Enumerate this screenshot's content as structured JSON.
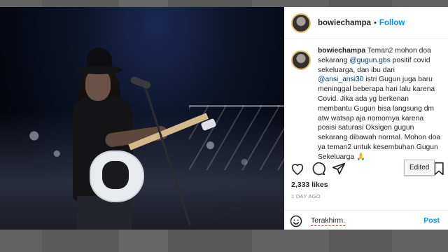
{
  "post": {
    "username": "bowiechampa",
    "follow_label": "Follow",
    "separator": "•",
    "caption": {
      "username": "bowiechampa",
      "text_1": " Teman2 mohon doa sekarang ",
      "mention_1": "@gugun.gbs",
      "text_2": " positif covid sekeluarga, dan ibu dari ",
      "mention_2": "@ansi_ansi30",
      "text_3": " istri Gugun juga baru meninggal beberapa hari lalu karena Covid. Jika ada yg berkenan membantu Gugun bisa langsung dm atw watsap aja nomornya karena posisi saturasi Oksigen gugun sekarang dibawah normal. Mohon doa ya teman2 untuk kesembuhan Gugun Sekeluarga 🙏"
    },
    "likes": "2,333 likes",
    "timestamp": "1 DAY AGO",
    "comment_placeholder": "Terakhirm.",
    "post_label": "Post",
    "tooltip": "Edited"
  },
  "icons": {
    "heart": "heart-icon",
    "comment": "comment-icon",
    "share": "share-icon",
    "bookmark": "bookmark-icon",
    "emoji": "emoji-icon"
  },
  "colors": {
    "link": "#00376b",
    "follow": "#0095f6",
    "avatar_ring": "#e3c16f"
  }
}
